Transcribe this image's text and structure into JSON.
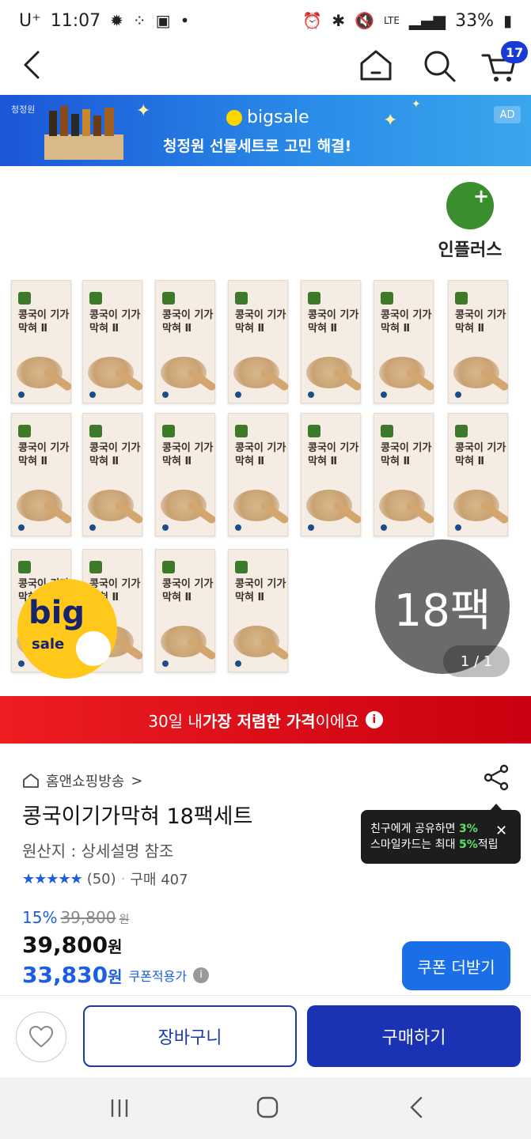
{
  "status_bar": {
    "carrier": "U⁺",
    "time": "11:07",
    "network": "LTE",
    "battery": "33%"
  },
  "header": {
    "cart_count": "17"
  },
  "banner": {
    "brand": "청정원",
    "logo": "bigsale",
    "text": "청정원 선물세트로 고민 해결!",
    "ad_label": "AD"
  },
  "product_image": {
    "brand_logo_text": "인플러스",
    "pack_title": "콩국이 기가막혀 Ⅱ",
    "count_label": "18팩",
    "counter": "1 / 1",
    "sticker_big": "big",
    "sticker_sale": "sale"
  },
  "lowest_banner": {
    "prefix": "30일 내 ",
    "highlight": "가장 저렴한 가격",
    "suffix": "이에요",
    "info": "i"
  },
  "product": {
    "seller": "홈앤쇼핑방송",
    "seller_chevron": ">",
    "title": "콩국이기가막혀 18팩세트",
    "origin": "원산지 : 상세설명 참조",
    "stars": "★★★★★",
    "rating_count": "(50)",
    "separator": "·",
    "purchase_count": "구매 407"
  },
  "tooltip": {
    "line1_prefix": "친구에게 공유하면 ",
    "line1_pct": "3%",
    "line2_prefix": "스마일카드는 최대 ",
    "line2_pct": "5%",
    "line2_suffix": "적립",
    "close": "✕"
  },
  "price": {
    "discount": "15%",
    "original": "39,800",
    "original_unit": "원",
    "current": "39,800",
    "current_unit": "원",
    "coupon_price": "33,830",
    "coupon_unit": "원",
    "coupon_label": "쿠폰적용가",
    "coupon_info": "i",
    "coupon_button": "쿠폰 더받기"
  },
  "bottom_bar": {
    "cart_button": "장바구니",
    "buy_button": "구매하기"
  },
  "colors": {
    "accent_blue": "#1b5fe0",
    "banner_red": "#ee1d22",
    "buy_blue": "#1a33b5"
  }
}
